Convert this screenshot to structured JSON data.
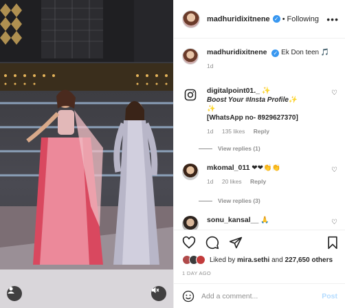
{
  "header": {
    "username": "madhuridixitnene",
    "separator": "•",
    "follow_label": "Following",
    "more_label": "•••"
  },
  "caption": {
    "username": "madhuridixitnene",
    "text": "Ek Don teen 🎵",
    "time": "1d"
  },
  "comments": [
    {
      "username": "digitalpoint01._ ✨",
      "line1": "Boost Your #Insta Profile✨",
      "line2": "✨",
      "line3": "[WhatsApp no- 8929627370]",
      "time": "1d",
      "likes": "135 likes",
      "reply": "Reply",
      "view_replies": "View replies (1)"
    },
    {
      "username": "mkomal_011",
      "text": "❤❤👏👏",
      "time": "1d",
      "likes": "20 likes",
      "reply": "Reply",
      "view_replies": "View replies (3)"
    },
    {
      "username": "sonu_kansal__",
      "text": "🙏"
    }
  ],
  "likes": {
    "prefix": "Liked by ",
    "user": "mira.sethi",
    "middle": " and ",
    "count": "227,650 others"
  },
  "posted_ago": "1 DAY AGO",
  "add_comment": {
    "placeholder": "Add a comment...",
    "post_label": "Post"
  },
  "colors": {
    "verified": "#3897f0",
    "post_disabled": "#b3dbff",
    "muted": "#8e8e8e"
  },
  "icons": [
    "heart-icon",
    "comment-icon",
    "share-icon",
    "bookmark-icon",
    "emoji-icon",
    "instagram-icon",
    "verified-icon",
    "mute-icon",
    "more-icon"
  ]
}
